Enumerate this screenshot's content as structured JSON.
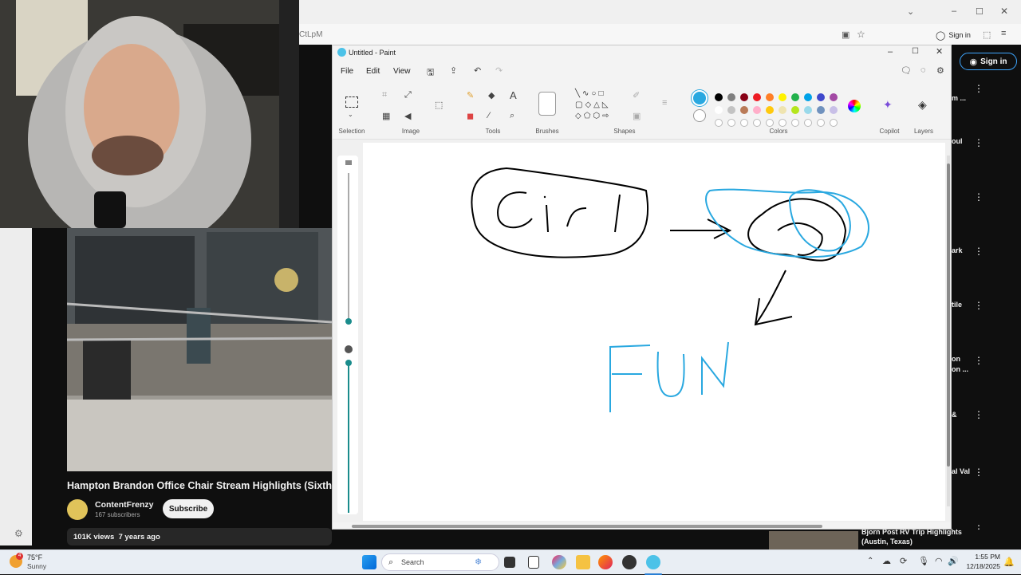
{
  "browser": {
    "address_fragment": "CtLpM",
    "sign_in_label": "Sign in"
  },
  "paint": {
    "title": "Untitled - Paint",
    "menus": [
      "File",
      "Edit",
      "View"
    ],
    "groups": {
      "selection": "Selection",
      "image": "Image",
      "tools": "Tools",
      "brushes": "Brushes",
      "shapes": "Shapes",
      "colors": "Colors",
      "copilot": "Copilot",
      "layers": "Layers"
    },
    "colors": {
      "primary": "#29a8e0",
      "row1": [
        "#000000",
        "#7f7f7f",
        "#880015",
        "#ed1c24",
        "#ff7f27",
        "#fff200",
        "#22b14c",
        "#00a2e8",
        "#3f48cc",
        "#a349a4"
      ],
      "row2": [
        "#ffffff",
        "#c3c3c3",
        "#b97a57",
        "#ffaec9",
        "#ffc90e",
        "#efe4b0",
        "#b5e61d",
        "#99d9ea",
        "#7092be",
        "#c8bfe7"
      ]
    }
  },
  "youtube": {
    "sign_in_label": "Sign in",
    "video_title": "Hampton Brandon Office Chair Stream Highlights (Sixth",
    "channel_name": "ContentFrenzy",
    "subscribers": "167 subscribers",
    "subscribe_label": "Subscribe",
    "views_date": "101K views  7 years ago",
    "sidebar_fragments": [
      "m ...",
      "oul",
      "ark",
      "tile",
      "on",
      "on ...",
      "&",
      "al Val"
    ],
    "bottom_item": "Bjorn Post RV Trip Highlights (Austin, Texas)"
  },
  "taskbar": {
    "weather_temp": "75°F",
    "weather_desc": "Sunny",
    "weather_badge": "4",
    "search_label": "Search",
    "time": "1:55 PM",
    "date": "12/18/2025"
  }
}
